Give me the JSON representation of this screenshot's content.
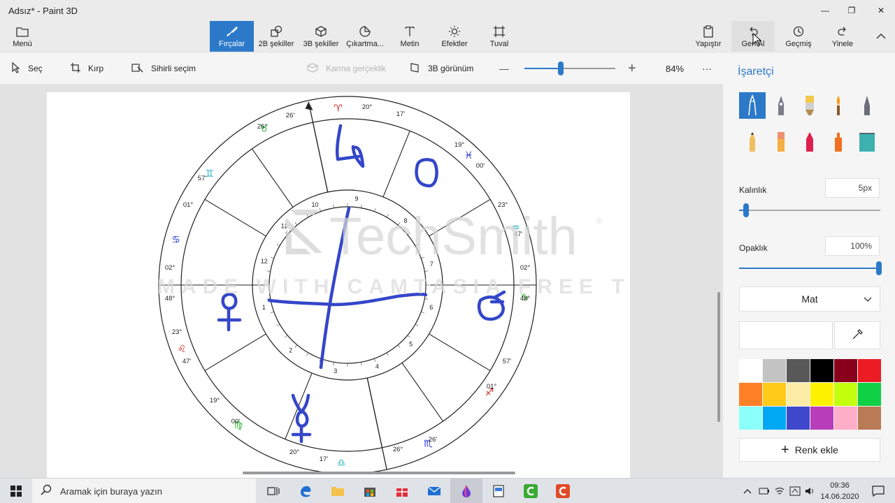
{
  "app": {
    "title": "Adsız* - Paint 3D"
  },
  "window_controls": {
    "minimize": "—",
    "maximize": "❐",
    "close": "✕"
  },
  "ribbon": {
    "menu": "Menü",
    "tools": [
      "Fırçalar",
      "2B şekiller",
      "3B şekiller",
      "Çıkartma...",
      "Metin",
      "Efektler",
      "Tuval"
    ],
    "right": [
      "Yapıştır",
      "Geri Al",
      "Geçmiş",
      "Yinele"
    ]
  },
  "toolbar": {
    "select": "Seç",
    "crop": "Kırp",
    "magic_select": "Sihirli seçim",
    "mixed_reality": "Karma gerçeklik",
    "view_3d": "3B görünüm",
    "zoom_minus": "—",
    "zoom_plus": "+",
    "zoom_level": "84%",
    "zoom_fraction": 0.4,
    "more": "···"
  },
  "watermark": {
    "brand": "TechSmith",
    "reg": "®",
    "trial": "MADE WITH CAMTASIA FREE TRIAL"
  },
  "chart": {
    "house_numbers": [
      "1",
      "2",
      "3",
      "4",
      "5",
      "6",
      "7",
      "8",
      "9",
      "10",
      "11",
      "12"
    ],
    "degree_labels": [
      "20°",
      "17'",
      "26°",
      "26'",
      "19°",
      "00'",
      "57'",
      "01°",
      "23°",
      "47'",
      "02°",
      "48°",
      "02°",
      "48°",
      "23°",
      "47'",
      "57'",
      "01°",
      "19°",
      "00'",
      "20°",
      "17'",
      "26°",
      "26'"
    ],
    "zodiac_glyphs": [
      "♈",
      "♉",
      "♊",
      "♋",
      "♌",
      "♍",
      "♎",
      "♏",
      "♐",
      "♑",
      "♒",
      "♓"
    ]
  },
  "panel": {
    "title": "İşaretçi",
    "thickness_label": "Kalınlık",
    "thickness_value": "5px",
    "thickness_fraction": 0.05,
    "opacity_label": "Opaklık",
    "opacity_value": "100%",
    "opacity_fraction": 1.0,
    "finish": "Mat",
    "add_color": "Renk ekle",
    "colors": [
      "#ffffff",
      "#c3c3c3",
      "#585858",
      "#000000",
      "#88001b",
      "#ec1c24",
      "#ff7f27",
      "#ffca18",
      "#fdeca6",
      "#fff200",
      "#c4ff0e",
      "#0ed145",
      "#8cfffb",
      "#00a8f3",
      "#3f48cc",
      "#b83dba",
      "#ffaec8",
      "#b97a56"
    ]
  },
  "taskbar": {
    "search_placeholder": "Aramak için buraya yazın",
    "time": "09:36",
    "date": "14.06.2020"
  }
}
